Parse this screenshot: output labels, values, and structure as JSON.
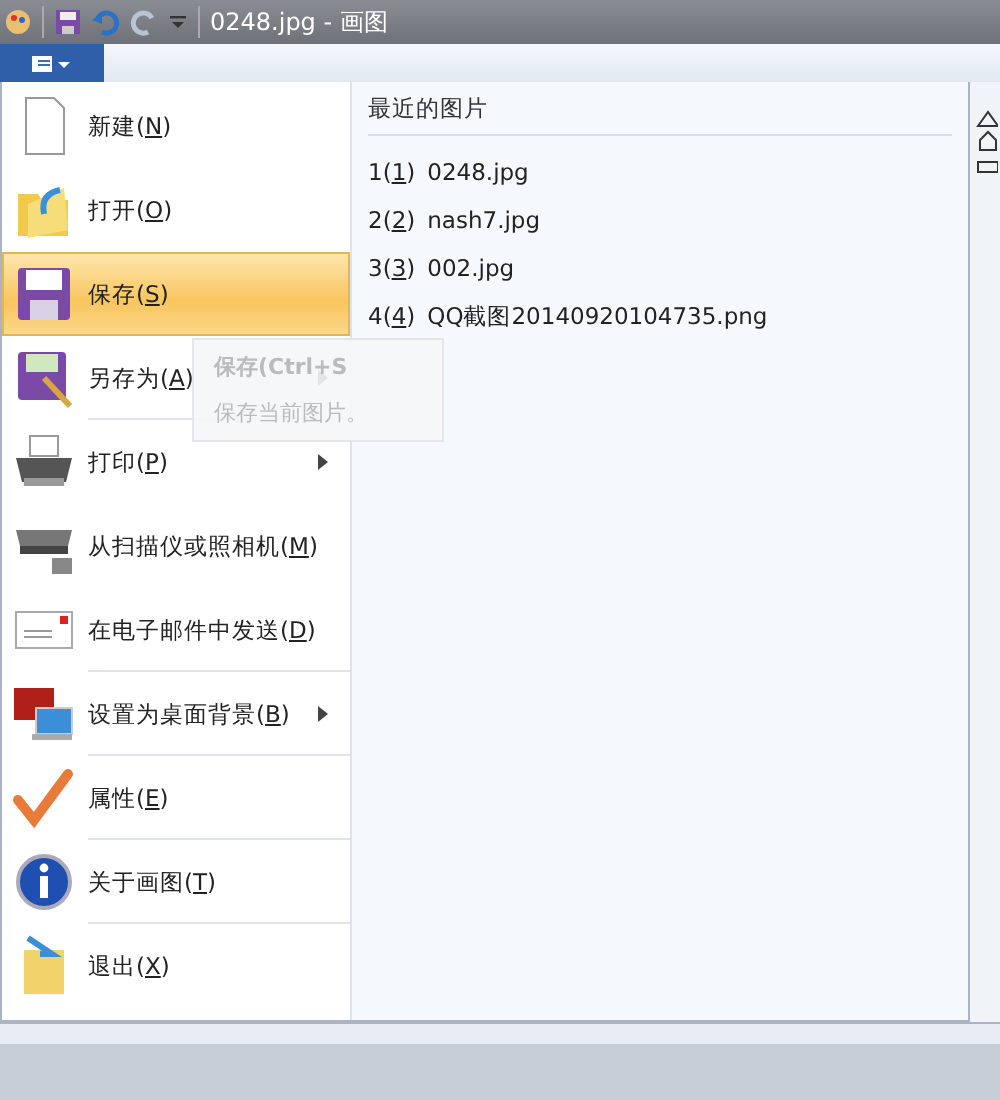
{
  "window": {
    "title": "0248.jpg - 画图"
  },
  "menu": {
    "items": [
      {
        "prefix": "新建(",
        "key": "N",
        "suffix": ")",
        "selected": false,
        "submenu": false,
        "separator_after": false
      },
      {
        "prefix": "打开(",
        "key": "O",
        "suffix": ")",
        "selected": false,
        "submenu": false,
        "separator_after": false
      },
      {
        "prefix": "保存(",
        "key": "S",
        "suffix": ")",
        "selected": true,
        "submenu": false,
        "separator_after": false
      },
      {
        "prefix": "另存为(",
        "key": "A",
        "suffix": ")",
        "selected": false,
        "submenu": true,
        "separator_after": true
      },
      {
        "prefix": "打印(",
        "key": "P",
        "suffix": ")",
        "selected": false,
        "submenu": true,
        "separator_after": false
      },
      {
        "prefix": "从扫描仪或照相机(",
        "key": "M",
        "suffix": ")",
        "selected": false,
        "submenu": false,
        "separator_after": false
      },
      {
        "prefix": "在电子邮件中发送(",
        "key": "D",
        "suffix": ")",
        "selected": false,
        "submenu": false,
        "separator_after": true
      },
      {
        "prefix": "设置为桌面背景(",
        "key": "B",
        "suffix": ")",
        "selected": false,
        "submenu": true,
        "separator_after": true
      },
      {
        "prefix": "属性(",
        "key": "E",
        "suffix": ")",
        "selected": false,
        "submenu": false,
        "separator_after": true
      },
      {
        "prefix": "关于画图(",
        "key": "T",
        "suffix": ")",
        "selected": false,
        "submenu": false,
        "separator_after": true
      },
      {
        "prefix": "退出(",
        "key": "X",
        "suffix": ")",
        "selected": false,
        "submenu": false,
        "separator_after": false
      }
    ]
  },
  "recent": {
    "title": "最近的图片",
    "items": [
      {
        "num": "1(",
        "key": "1",
        "close": ")",
        "name": "0248.jpg"
      },
      {
        "num": "2(",
        "key": "2",
        "close": ")",
        "name": "nash7.jpg"
      },
      {
        "num": "3(",
        "key": "3",
        "close": ")",
        "name": "002.jpg"
      },
      {
        "num": "4(",
        "key": "4",
        "close": ")",
        "name": "QQ截图20140920104735.png"
      }
    ]
  },
  "tooltip": {
    "title": "保存(Ctrl+S",
    "text": "保存当前图片。"
  }
}
